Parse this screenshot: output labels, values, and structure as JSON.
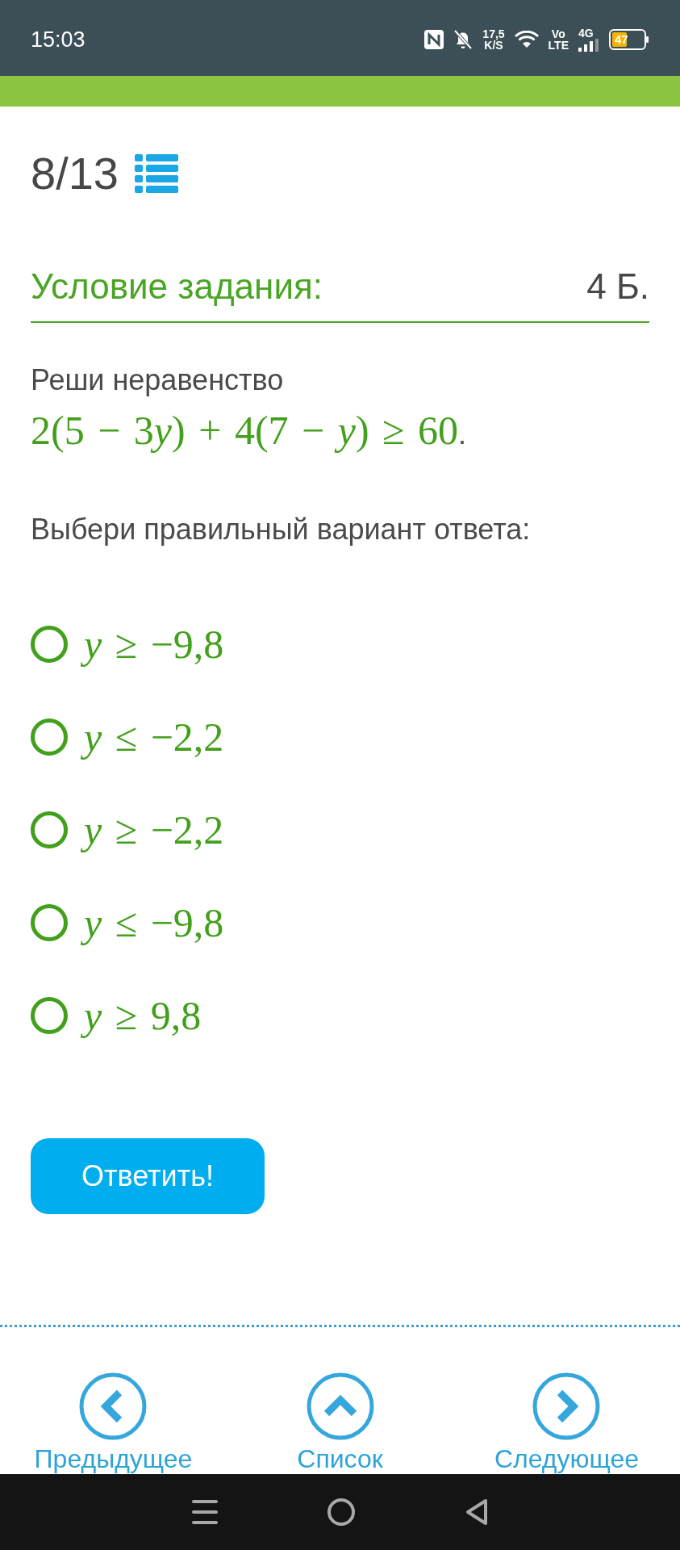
{
  "status_bar": {
    "time": "15:03",
    "network_speed": "17,5",
    "speed_unit": "K/S",
    "volte": [
      "Vo",
      "LTE"
    ],
    "network_type": "4G",
    "battery": "47"
  },
  "progress": {
    "counter": "8/13"
  },
  "section": {
    "title": "Условие задания:",
    "points": "4 Б."
  },
  "problem": {
    "instruction": "Реши неравенство",
    "expression": "2(5 − 3y) + 4(7 − y) ≥ 60",
    "punctuation": ".",
    "prompt": "Выбери правильный вариант ответа:"
  },
  "options": [
    {
      "label": "y ≥ −9,8",
      "selected": false
    },
    {
      "label": "y ≤ −2,2",
      "selected": false
    },
    {
      "label": "y ≥ −2,2",
      "selected": false
    },
    {
      "label": "y ≤ −9,8",
      "selected": false
    },
    {
      "label": "y ≥ 9,8",
      "selected": false
    }
  ],
  "submit_button": "Ответить!",
  "navigation": [
    {
      "kind": "previous",
      "label": "Предыдущее"
    },
    {
      "kind": "list",
      "label": "Список"
    },
    {
      "kind": "next",
      "label": "Следующее"
    }
  ]
}
